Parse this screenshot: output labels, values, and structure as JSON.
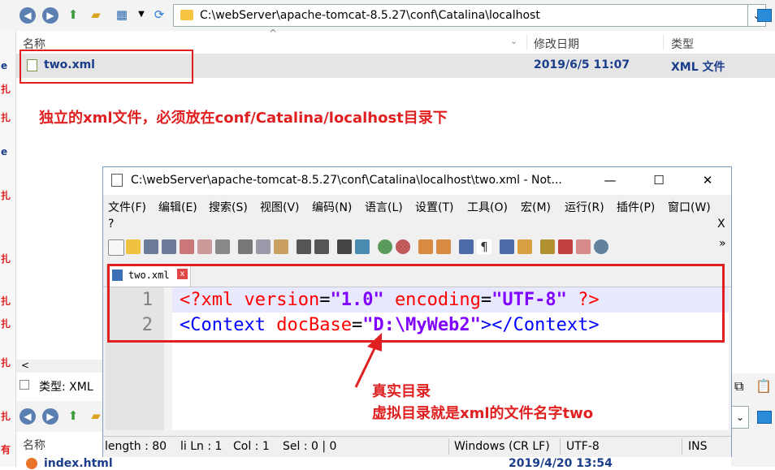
{
  "explorer": {
    "address_path": "C:\\webServer\\apache-tomcat-8.5.27\\conf\\Catalina\\localhost",
    "col_name": "名称",
    "col_date": "修改日期",
    "col_type": "类型",
    "file_name": "two.xml",
    "file_date": "2019/6/5 11:07",
    "file_type": "XML 文件",
    "status_type": "类型: XML",
    "col_name2": "名称",
    "row3_name": "index.html",
    "row3_date": "2019/4/20 13:54",
    "left_glyphs": [
      "e",
      "扎",
      "扎",
      "e",
      "扎",
      "扎",
      "扎",
      "扎",
      "扎",
      "扎",
      "有"
    ]
  },
  "annotations": {
    "top_note": "独立的xml文件，必须放在conf/Catalina/localhost目录下",
    "real_dir": "真实目录",
    "virtual_dir": "虚拟目录就是xml的文件名字two"
  },
  "notepad": {
    "title": "C:\\webServer\\apache-tomcat-8.5.27\\conf\\Catalina\\localhost\\two.xml - Not...",
    "minimize": "—",
    "maximize": "☐",
    "close": "✕",
    "menu": [
      "文件(F)",
      "编辑(E)",
      "搜索(S)",
      "视图(V)",
      "编码(N)",
      "语言(L)",
      "设置(T)",
      "工具(O)",
      "宏(M)",
      "运行(R)",
      "插件(P)",
      "窗口(W)"
    ],
    "menu_help": "?",
    "menu_close": "X",
    "tab_label": "two.xml",
    "tab_close": "x",
    "line_numbers": [
      "1",
      "2"
    ],
    "line1": {
      "pi_open": "<?xml",
      "attr1": "version",
      "eq1": "=",
      "val1": "\"1.0\"",
      "attr2": "encoding",
      "eq2": "=",
      "val2": "\"UTF-8\"",
      "pi_close": "?>"
    },
    "line2": {
      "tag_open": "<Context",
      "attr": "docBase",
      "eq": "=",
      "val": "\"D:\\MyWeb2\"",
      "tag_close": "></Context>"
    },
    "status": {
      "length": "length : 80",
      "ln": "li Ln : 1",
      "col": "Col : 1",
      "sel": "Sel : 0 | 0",
      "eol": "Windows (CR LF)",
      "encoding": "UTF-8",
      "mode": "INS"
    }
  }
}
